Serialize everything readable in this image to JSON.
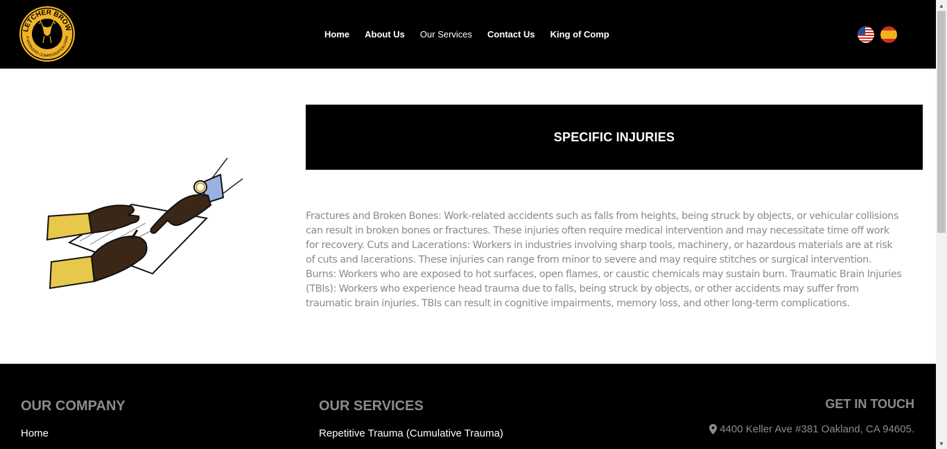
{
  "header": {
    "logo_text_top": "FLETCHER BROWN",
    "logo_text_bottom": "A WORKERS COMPENSATION FIRM",
    "nav": [
      {
        "label": "Home"
      },
      {
        "label": "About Us"
      },
      {
        "label": "Our Services"
      },
      {
        "label": "Contact Us"
      },
      {
        "label": "King of Comp"
      }
    ],
    "flags": [
      "us-flag-icon",
      "spain-flag-icon"
    ]
  },
  "main": {
    "title": "SPECIFIC INJURIES",
    "body": "Fractures and Broken Bones: Work-related accidents such as falls from heights, being struck by objects, or vehicular collisions can result in broken bones or fractures. These injuries often require medical intervention and may necessitate time off work for recovery. Cuts and Lacerations: Workers in industries involving sharp tools, machinery, or hazardous materials are at risk of cuts and lacerations. These injuries can range from minor to severe and may require stitches or surgical intervention. Burns: Workers who are exposed to hot surfaces, open flames, or caustic chemicals may sustain burn. Traumatic Brain Injuries (TBIs): Workers who experience head trauma due to falls, being struck by objects, or other accidents may suffer from traumatic brain injuries. TBIs can result in cognitive impairments, memory loss, and other long-term complications."
  },
  "footer": {
    "company_heading": "OUR COMPANY",
    "company_links": [
      "Home"
    ],
    "services_heading": "OUR SERVICES",
    "services_links": [
      "Repetitive Trauma (Cumulative Trauma)"
    ],
    "contact_heading": "GET IN TOUCH",
    "address": "4400 Keller Ave #381 Oakland, CA 94605."
  },
  "colors": {
    "header_bg": "#000000",
    "logo_gold": "#f0b429",
    "body_text": "#8a8a8a",
    "footer_heading": "#8c8c8c"
  }
}
